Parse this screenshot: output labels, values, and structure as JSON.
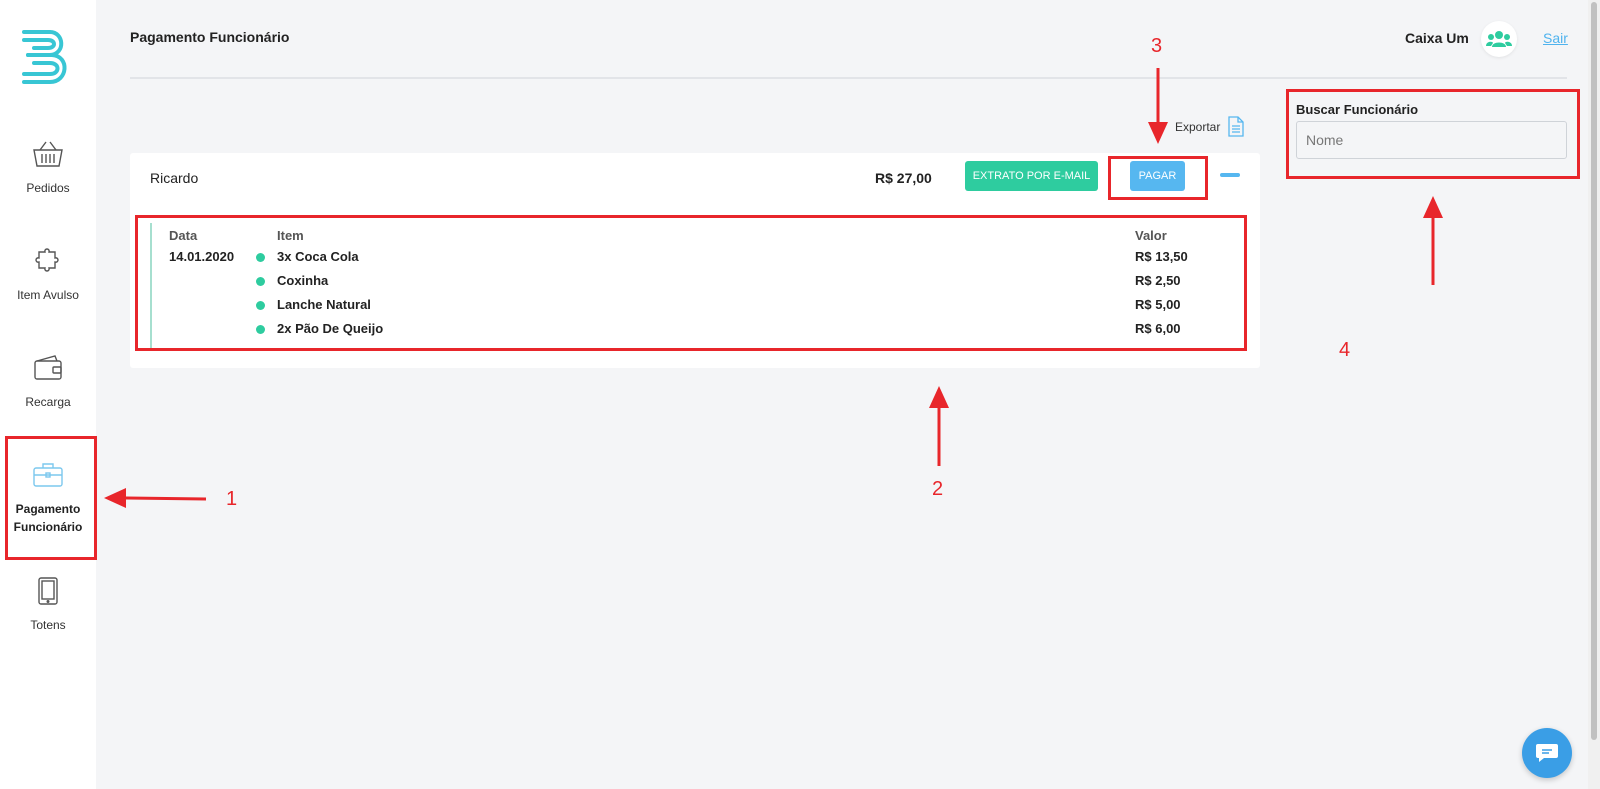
{
  "app": {
    "title": "Pagamento Funcionário"
  },
  "colors": {
    "accent_green": "#2ecc9f",
    "accent_blue": "#56b7f0",
    "annotation_red": "#e8262b",
    "nav_icon": "#555555",
    "active_icon": "#7cc8ee"
  },
  "sidebar": {
    "logo_icon": "brand-logo-icon",
    "items": [
      {
        "label": "Pedidos",
        "icon": "basket-icon",
        "active": false
      },
      {
        "label": "Item Avulso",
        "icon": "puzzle-icon",
        "active": false
      },
      {
        "label": "Recarga",
        "icon": "wallet-icon",
        "active": false
      },
      {
        "label": "Pagamento Funcionário",
        "icon": "briefcase-icon",
        "active": true
      },
      {
        "label": "Totens",
        "icon": "tablet-icon",
        "active": false
      }
    ]
  },
  "header": {
    "title": "Pagamento Funcionário",
    "user_name": "Caixa Um",
    "avatar_icon": "users-icon",
    "logout_label": "Sair"
  },
  "export": {
    "label": "Exportar",
    "icon": "document-icon"
  },
  "employee_card": {
    "name": "Ricardo",
    "total": "R$ 27,00",
    "extrato_button": "EXTRATO POR E-MAIL",
    "pay_button": "PAGAR",
    "collapse_icon": "minus-icon",
    "columns": {
      "date": "Data",
      "item": "Item",
      "value": "Valor"
    },
    "date": "14.01.2020",
    "items": [
      {
        "name": "3x Coca Cola",
        "value": "R$ 13,50"
      },
      {
        "name": "Coxinha",
        "value": "R$ 2,50"
      },
      {
        "name": "Lanche Natural",
        "value": "R$ 5,00"
      },
      {
        "name": "2x Pão De Queijo",
        "value": "R$ 6,00"
      }
    ]
  },
  "search": {
    "label": "Buscar Funcionário",
    "placeholder": "Nome",
    "value": ""
  },
  "annotations": [
    "1",
    "2",
    "3",
    "4"
  ],
  "chat": {
    "icon": "chat-icon"
  }
}
